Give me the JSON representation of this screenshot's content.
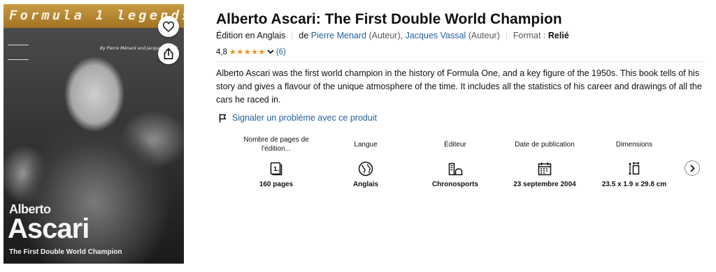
{
  "cover": {
    "top_title": "Formula 1 legends",
    "authors_small": "By Pierre Ménard and Jacques Vassal",
    "name_first": "Alberto",
    "name_last": "Ascari",
    "subtitle": "The First Double World Champion"
  },
  "product": {
    "title": "Alberto Ascari: The First Double World Champion",
    "edition": "Édition en Anglais",
    "by_prefix": "de",
    "author1": "Pierre Menard",
    "author1_role": "(Auteur),",
    "author2": "Jacques Vassal",
    "author2_role": "(Auteur)",
    "format_label": "Format :",
    "format_value": "Relié"
  },
  "rating": {
    "value": "4,8",
    "stars": "★★★★★",
    "stars_value": 4.8,
    "chevron": "⌄",
    "count": "(6)"
  },
  "description": "Alberto Ascari was the first world champion in the history of Formula One, and a key figure of the 1950s. This book tells of his story and gives a flavour of the unique atmosphere of the time. It includes all the statistics of his career and drawings of all the cars he raced in.",
  "report_link": "Signaler un problème avec ce produit",
  "attributes": [
    {
      "label": "Nombre de pages de l'édition...",
      "icon": "pages-icon",
      "value": "160 pages"
    },
    {
      "label": "Langue",
      "icon": "globe-icon",
      "value": "Anglais"
    },
    {
      "label": "Éditeur",
      "icon": "publisher-icon",
      "value": "Chronosports"
    },
    {
      "label": "Date de publication",
      "icon": "calendar-icon",
      "value": "23 septembre 2004"
    },
    {
      "label": "Dimensions",
      "icon": "dimensions-icon",
      "value": "23.5 x 1.9 x 29.8 cm"
    }
  ],
  "colors": {
    "link": "#2162a1",
    "star": "#f48c0e",
    "text": "#0f1111",
    "muted": "#565959"
  }
}
